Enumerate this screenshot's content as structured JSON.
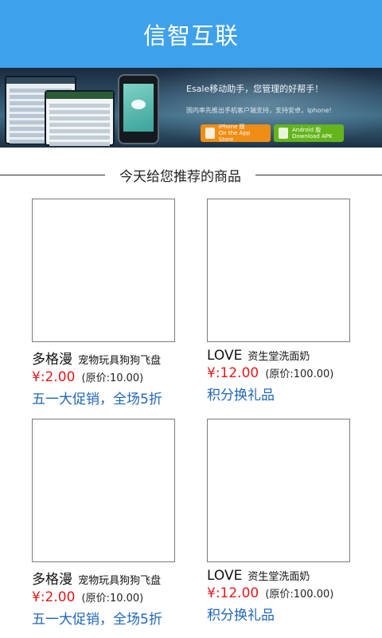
{
  "header": {
    "title": "信智互联"
  },
  "banner": {
    "headline": "Esale移动助手，您管理的好帮手！",
    "subline": "国内率先推出手机客户端支持，支持安卓，Iphone!",
    "iphone_button": {
      "title": "iPhone 版",
      "subtitle": "On the App Store"
    },
    "android_button": {
      "title": "Android 版",
      "subtitle": "Download APK"
    }
  },
  "section": {
    "title": "今天给您推荐的商品"
  },
  "products": [
    {
      "brand": "多格漫",
      "desc": "宠物玩具狗狗飞盘",
      "price": "¥:2.00",
      "original": "(原价:10.00)",
      "promo": "五一大促销，全场5折"
    },
    {
      "brand": "LOVE",
      "desc": "资生堂洗面奶",
      "price": "¥:12.00",
      "original": "(原价:100.00)",
      "promo": "积分换礼品"
    },
    {
      "brand": "多格漫",
      "desc": "宠物玩具狗狗飞盘",
      "price": "¥:2.00",
      "original": "(原价:10.00)",
      "promo": "五一大促销，全场5折"
    },
    {
      "brand": "LOVE",
      "desc": "资生堂洗面奶",
      "price": "¥:12.00",
      "original": "(原价:100.00)",
      "promo": "积分换礼品"
    }
  ],
  "colors": {
    "header_bg": "#3ea1eb",
    "price": "#e3191b",
    "promo": "#2067b8",
    "iphone_button": "#f08d14",
    "android_button": "#63b51b"
  }
}
